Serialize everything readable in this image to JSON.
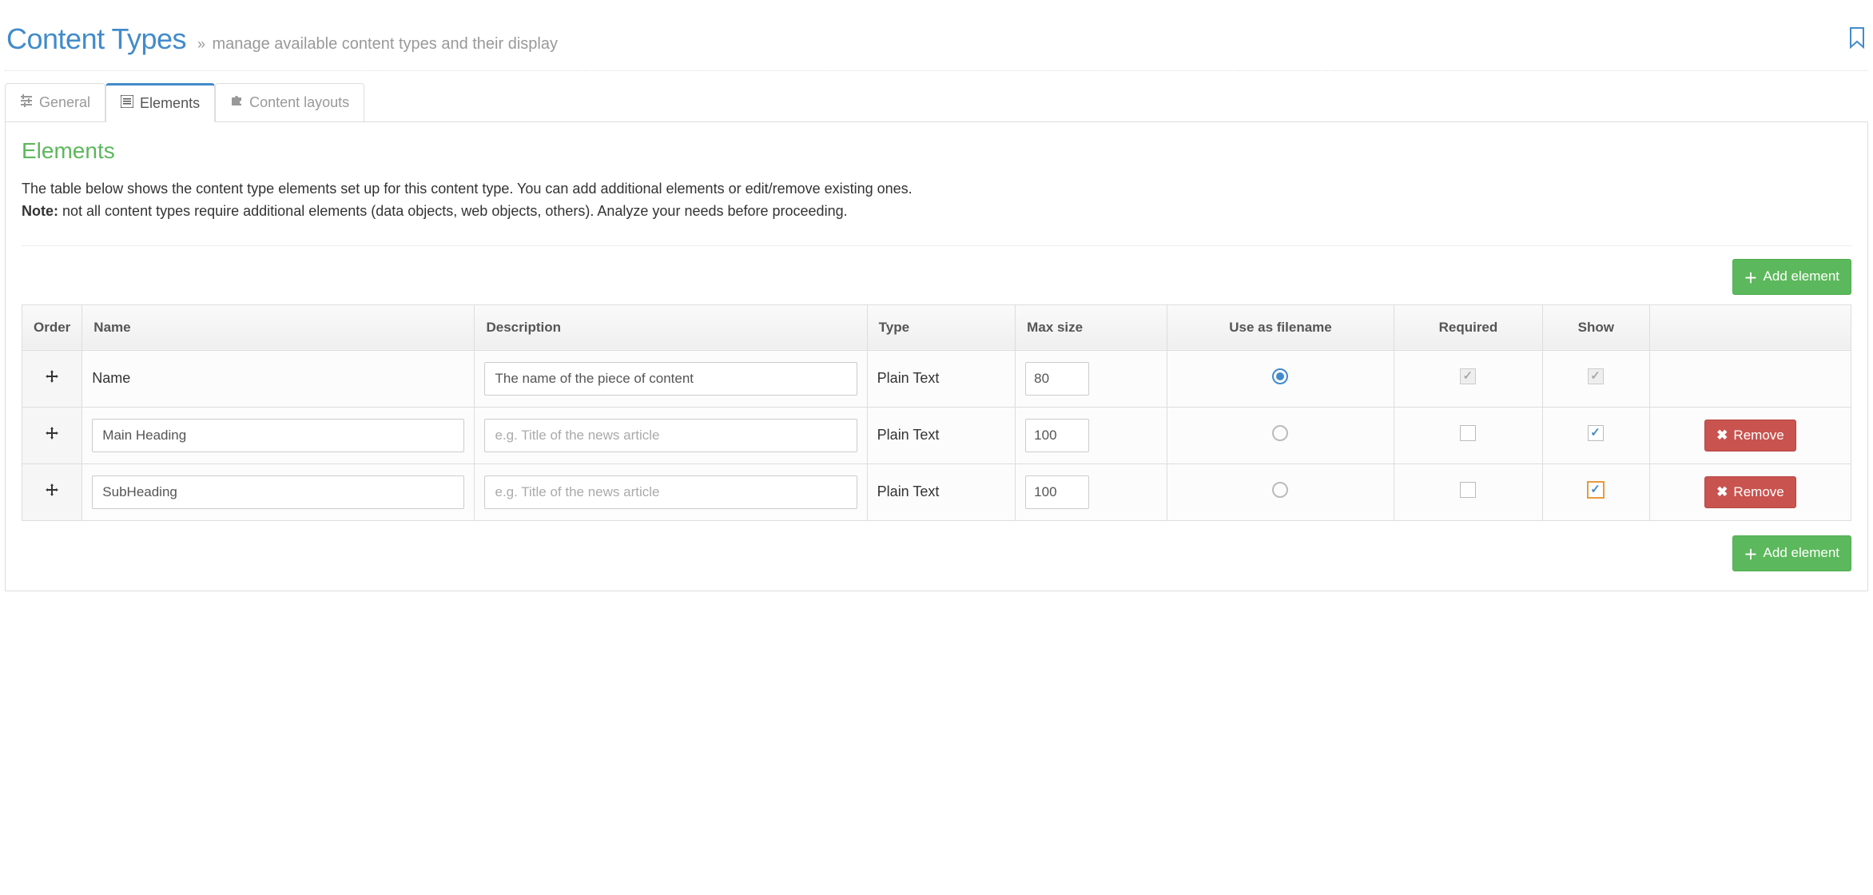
{
  "header": {
    "title": "Content Types",
    "subtitle": "manage available content types and their display"
  },
  "tabs": {
    "general": "General",
    "elements": "Elements",
    "layouts": "Content layouts"
  },
  "section": {
    "title": "Elements",
    "intro1": "The table below shows the content type elements set up for this content type. You can add additional elements or edit/remove existing ones.",
    "note_label": "Note:",
    "intro2": " not all content types require additional elements (data objects, web objects, others). Analyze your needs before proceeding."
  },
  "buttons": {
    "add_element": "Add element",
    "remove": "Remove"
  },
  "table": {
    "headers": {
      "order": "Order",
      "name": "Name",
      "description": "Description",
      "type": "Type",
      "maxsize": "Max size",
      "useas": "Use as filename",
      "required": "Required",
      "show": "Show"
    },
    "desc_placeholder": "e.g. Title of the news article",
    "rows": [
      {
        "name_text": "Name",
        "name_is_static": true,
        "description_value": "The name of the piece of content",
        "type": "Plain Text",
        "maxsize": "80",
        "use_as_filename": true,
        "required_checked": true,
        "required_disabled": true,
        "show_checked": true,
        "show_disabled": true,
        "show_focus": false,
        "removable": false
      },
      {
        "name_text": "Main Heading",
        "name_is_static": false,
        "description_value": "",
        "type": "Plain Text",
        "maxsize": "100",
        "use_as_filename": false,
        "required_checked": false,
        "required_disabled": false,
        "show_checked": true,
        "show_disabled": false,
        "show_focus": false,
        "removable": true
      },
      {
        "name_text": "SubHeading",
        "name_is_static": false,
        "description_value": "",
        "type": "Plain Text",
        "maxsize": "100",
        "use_as_filename": false,
        "required_checked": false,
        "required_disabled": false,
        "show_checked": true,
        "show_disabled": false,
        "show_focus": true,
        "removable": true
      }
    ]
  }
}
